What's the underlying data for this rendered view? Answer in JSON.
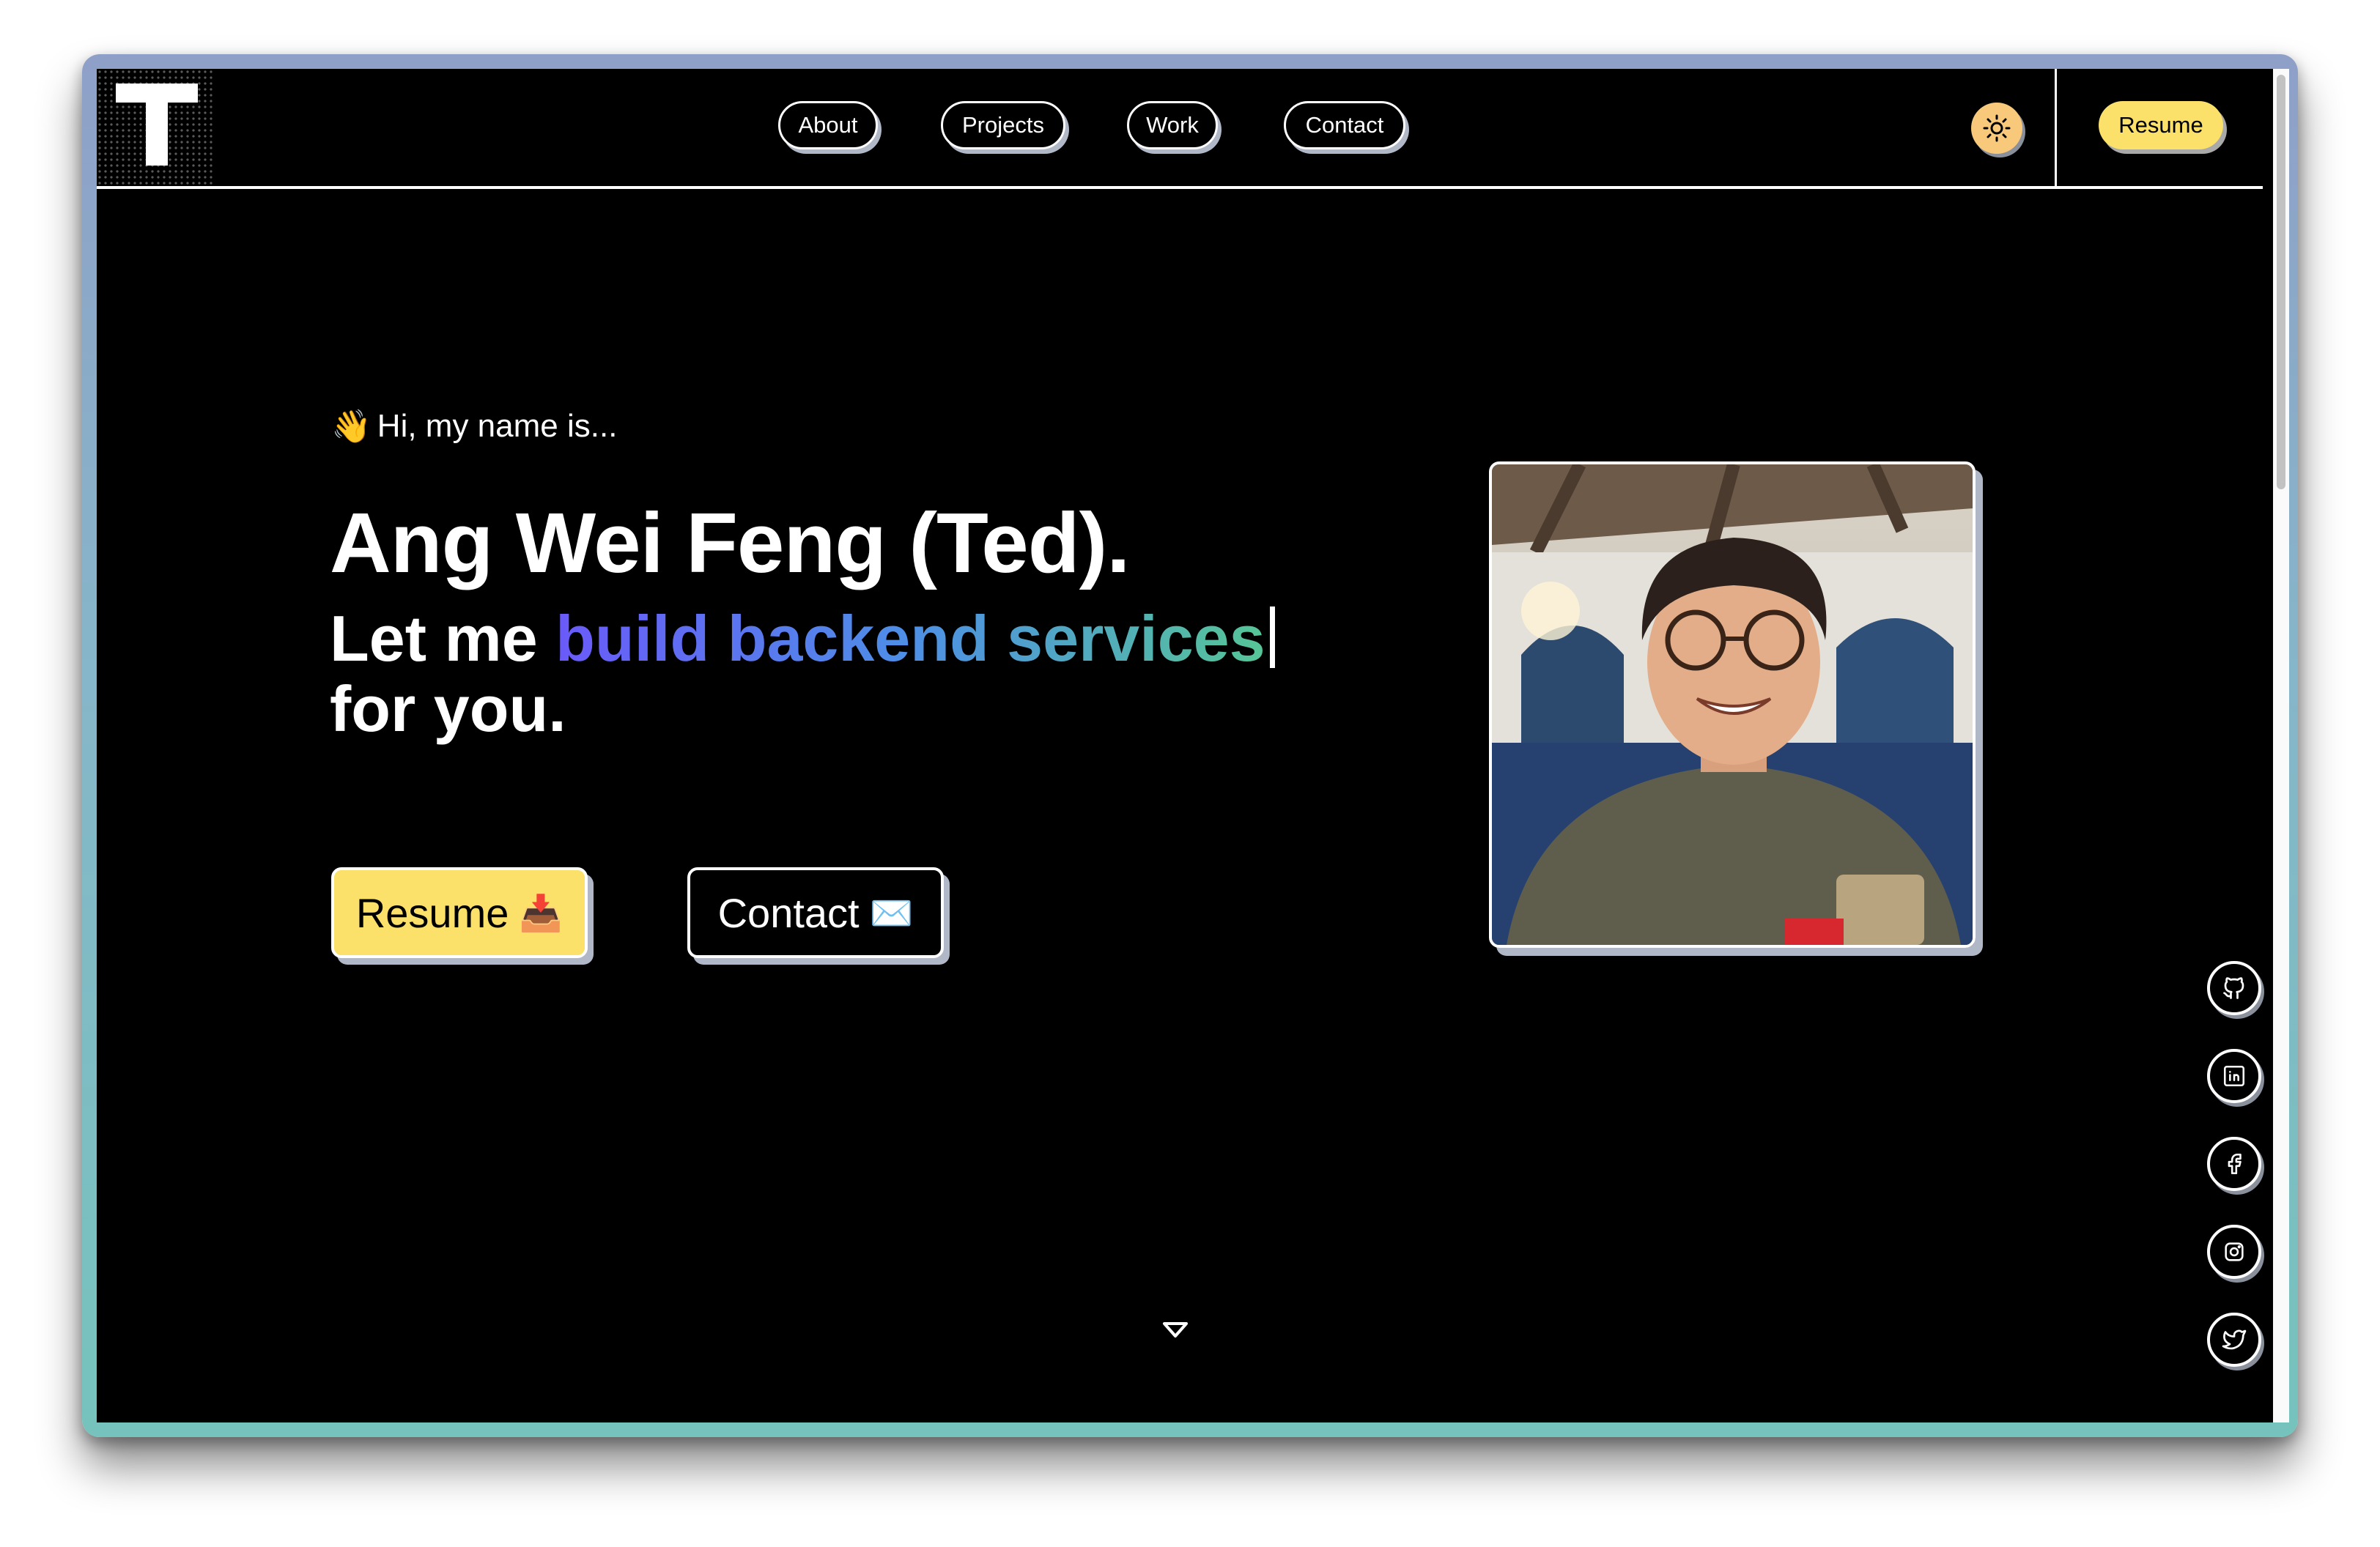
{
  "nav": {
    "logo_letter": "T",
    "links": [
      {
        "label": "About"
      },
      {
        "label": "Projects"
      },
      {
        "label": "Work"
      },
      {
        "label": "Contact"
      }
    ],
    "theme_icon": "sun-icon",
    "resume_label": "Resume"
  },
  "hero": {
    "greeting_emoji": "👋",
    "greeting": "Hi, my name is...",
    "name": "Ang Wei Feng (Ted).",
    "tagline_prefix": "Let me ",
    "tagline_highlight": "build backend services",
    "tagline_suffix": "for you.",
    "resume_button": "Resume",
    "resume_icon": "📥",
    "contact_button": "Contact",
    "contact_icon": "✉️"
  },
  "social": [
    {
      "icon": "github-icon"
    },
    {
      "icon": "linkedin-icon"
    },
    {
      "icon": "facebook-icon"
    },
    {
      "icon": "instagram-icon"
    },
    {
      "icon": "twitter-icon"
    }
  ],
  "colors": {
    "accent_yellow": "#fbe06a",
    "gradient_start": "#6a5af9",
    "gradient_mid": "#4d8fe6",
    "gradient_end": "#56c596",
    "theme_button": "#f9c97b",
    "background": "#000000"
  }
}
